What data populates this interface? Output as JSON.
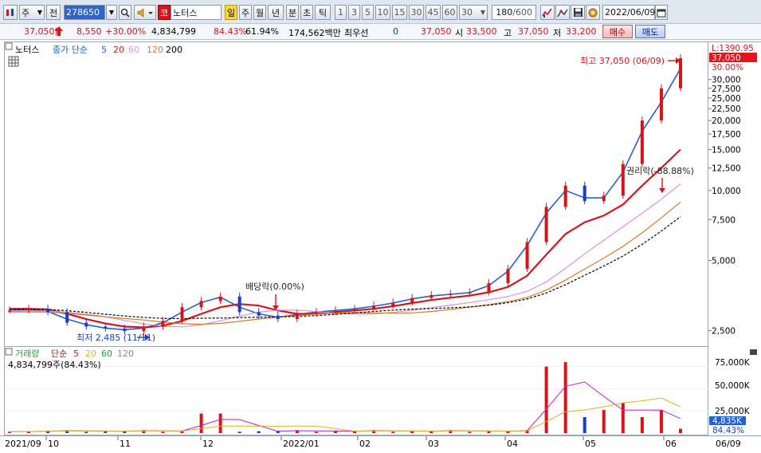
{
  "toolbar": {
    "type_select": "주",
    "prev_button": "전",
    "code_value": "278650",
    "name_value": "노터스",
    "periods": [
      "일",
      "주",
      "월",
      "년",
      "분",
      "초",
      "틱"
    ],
    "active_period": "일",
    "intervals": [
      "1",
      "3",
      "5",
      "10",
      "15",
      "30",
      "45",
      "60"
    ],
    "interval_select": "30",
    "count_value": "180",
    "count_total": "/600",
    "date_value": "2022/06/09"
  },
  "info": {
    "price": "37,050",
    "change": "8,550",
    "change_pct": "+30.00%",
    "volume": "4,834,799",
    "vol_ratio": "84.43%",
    "turnover": "61.94%",
    "amount": "174,562백만",
    "priority_label": "최우선",
    "priority_value": "0",
    "price2": "37,050",
    "open_label": "시",
    "open": "33,500",
    "high_label": "고",
    "high": "37,050",
    "low_label": "저",
    "low": "33,200",
    "buy_button": "매수",
    "sell_button": "매도"
  },
  "price_legend": {
    "name": "노터스",
    "label": "종가 단순",
    "periods": [
      "5",
      "20",
      "60",
      "120",
      "200"
    ],
    "colors": [
      "#2060d8",
      "#d8141b",
      "#d890e0",
      "#d87a1e",
      "#000000"
    ]
  },
  "volume_legend": {
    "name": "거래량",
    "label": "단순",
    "periods": [
      "5",
      "20",
      "60",
      "120"
    ],
    "colors": [
      "#d8141b",
      "#e0b020",
      "#20a030",
      "#888888"
    ],
    "value": "4,834,799주(84.43%)"
  },
  "annotations": {
    "high": "최고 37,050 (06/09)",
    "low": "최저 2,485 (11/11)",
    "dividend": "배당락(0.00%)",
    "rights": "권리락(-88.88%)"
  },
  "price_axis": {
    "top_value": "L:1390.95",
    "current": "37,050",
    "current_pct": "30.00%",
    "ticks": [
      "30,000",
      "27,500",
      "25,000",
      "22,500",
      "20,000",
      "17,500",
      "15,000",
      "12,500",
      "10,000",
      "7,500",
      "5,000",
      "2,500"
    ]
  },
  "volume_axis": {
    "ticks": [
      "75,000K",
      "50,000K",
      "25,000K"
    ],
    "current": "4,835K",
    "current_pct": "84.43%"
  },
  "date_axis": {
    "labels": [
      "2021/09",
      "10",
      "11",
      "12",
      "2022/01",
      "02",
      "03",
      "04",
      "05",
      "06",
      "06/09"
    ]
  },
  "colors": {
    "up": "#d8141b",
    "down": "#1b3fc4",
    "ma5": "#2060d8",
    "ma20": "#d8141b",
    "ma60": "#d890e0",
    "ma120": "#d87a1e",
    "ma200": "#000000"
  },
  "chart_data": {
    "type": "candlestick",
    "title": "노터스",
    "y_scale": "log",
    "ylim": [
      2300,
      37050
    ],
    "x_range": [
      "2021/09",
      "2022/06/09"
    ],
    "x_labels": [
      "2021/09",
      "10",
      "11",
      "12",
      "2022/01",
      "02",
      "03",
      "04",
      "05",
      "06"
    ],
    "last": {
      "date": "06/09",
      "open": 33500,
      "high": 37050,
      "low": 33200,
      "close": 37050,
      "volume": 4834799
    },
    "approx_closes": [
      3050,
      3100,
      3000,
      2700,
      2600,
      2550,
      2485,
      2600,
      2750,
      3150,
      3350,
      3500,
      3000,
      2900,
      2800,
      2950,
      3000,
      3050,
      3100,
      3200,
      3300,
      3450,
      3550,
      3600,
      3650,
      4000,
      4600,
      6000,
      8500,
      10500,
      9000,
      9500,
      13000,
      20000,
      27500,
      37050
    ],
    "series": [
      {
        "name": "종가 단순 5",
        "approx_values": [
          3050,
          3080,
          3020,
          2800,
          2650,
          2560,
          2520,
          2560,
          2700,
          3000,
          3300,
          3480,
          3150,
          2950,
          2850,
          2930,
          3000,
          3050,
          3100,
          3180,
          3280,
          3420,
          3520,
          3580,
          3640,
          3900,
          4500,
          5800,
          8000,
          10000,
          9300,
          9300,
          12000,
          18000,
          24000,
          33500
        ]
      },
      {
        "name": "20",
        "approx_values": [
          3100,
          3100,
          3080,
          2950,
          2800,
          2680,
          2600,
          2580,
          2620,
          2750,
          2950,
          3150,
          3250,
          3200,
          3050,
          2950,
          2950,
          3000,
          3050,
          3100,
          3180,
          3280,
          3380,
          3460,
          3530,
          3650,
          3850,
          4300,
          5300,
          6500,
          7300,
          7800,
          8700,
          10500,
          12500,
          15000
        ]
      }
    ],
    "volume": {
      "unit": "K",
      "ylim": [
        0,
        90000
      ],
      "peaks": [
        {
          "label": "05 early",
          "value": 75000
        },
        {
          "label": "05 early",
          "value": 80000
        },
        {
          "label": "12 mid",
          "value": 22000
        }
      ],
      "last": 4835
    }
  }
}
